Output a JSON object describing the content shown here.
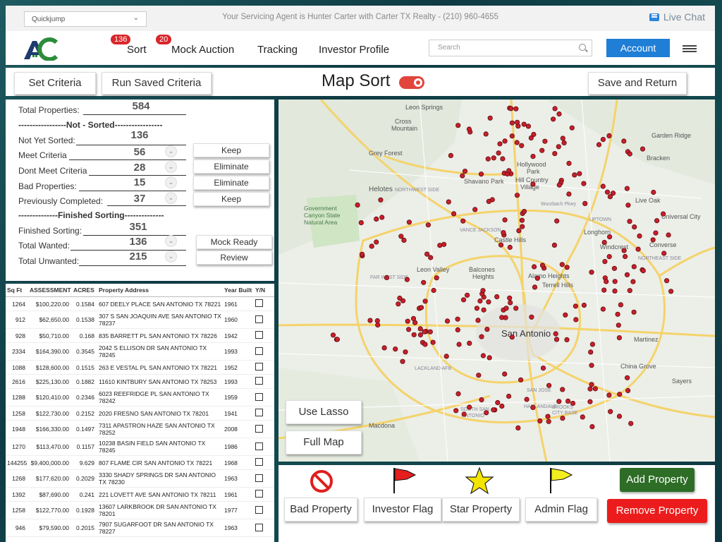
{
  "topbar": {
    "quickjump": "Quickjump",
    "agent_text": "Your Servicing Agent is Hunter Carter with Carter TX Realty - (210) 960-4655",
    "live_chat": "Live Chat"
  },
  "nav": {
    "logo_icon": "ac-house-logo",
    "items": [
      {
        "label": "Sort",
        "badge": "136"
      },
      {
        "label": "Mock Auction",
        "badge": "20"
      },
      {
        "label": "Tracking"
      },
      {
        "label": "Investor Profile"
      }
    ],
    "search_placeholder": "Search",
    "account": "Account"
  },
  "controls": {
    "set_criteria": "Set Criteria",
    "run_saved": "Run Saved Criteria",
    "title": "Map Sort",
    "toggle_on": true,
    "save_return": "Save and Return"
  },
  "stats": {
    "total_label": "Total Properties:",
    "total_value": "584",
    "not_sorted_sep": "-----------------Not - Sorted-----------------",
    "not_yet_label": "Not Yet Sorted:",
    "not_yet_value": "136",
    "rows": [
      {
        "label": "Meet Criteria",
        "value": "56",
        "button": "Keep"
      },
      {
        "label": "Dont Meet Criteria",
        "value": "28",
        "button": "Eliminate"
      },
      {
        "label": "Bad Properties:",
        "value": "15",
        "button": "Eliminate"
      },
      {
        "label": "Previously Completed:",
        "value": "37",
        "button": "Keep"
      }
    ],
    "finished_sep": "--------------Finished Sorting--------------",
    "finished_label": "Finished Sorting:",
    "finished_value": "351",
    "wanted_label": "Total Wanted:",
    "wanted_value": "136",
    "wanted_button": "Mock Ready",
    "unwanted_label": "Total Unwanted:",
    "unwanted_value": "215",
    "unwanted_button": "Review"
  },
  "table": {
    "headers": [
      "Sq Ft",
      "ASSESSMENT",
      "ACRES",
      "Property Address",
      "Year Built",
      "Y/N"
    ],
    "rows": [
      [
        "1264",
        "$100,220.00",
        "0.1584",
        "607 DEELY PLACE SAN ANTONIO TX 78221",
        "1961"
      ],
      [
        "912",
        "$62,650.00",
        "0.1538",
        "307 S SAN JOAQUIN AVE SAN ANTONIO TX 78237",
        "1960"
      ],
      [
        "928",
        "$50,710.00",
        "0.168",
        "835 BARRETT PL SAN ANTONIO TX 78226",
        "1942"
      ],
      [
        "2334",
        "$164,390.00",
        "0.3545",
        "2042 S ELLISON DR SAN ANTONIO TX 78245",
        "1993"
      ],
      [
        "1088",
        "$128,600.00",
        "0.1515",
        "263 E VESTAL PL SAN ANTONIO TX 78221",
        "1952"
      ],
      [
        "2616",
        "$225,130.00",
        "0.1882",
        "11610 KINTBURY SAN ANTONIO TX 78253",
        "1993"
      ],
      [
        "1288",
        "$120,410.00",
        "0.2346",
        "6023 REEFRIDGE PL SAN ANTONIO TX 78242",
        "1959"
      ],
      [
        "1258",
        "$122,730.00",
        "0.2152",
        "2020 FRESNO SAN ANTONIO TX 78201",
        "1941"
      ],
      [
        "1948",
        "$166,330.00",
        "0.1497",
        "7311 APASTRON HAZE SAN ANTONIO TX 78252",
        "2008"
      ],
      [
        "1270",
        "$113,470.00",
        "0.1157",
        "10238 BASIN FIELD SAN ANTONIO TX 78245",
        "1986"
      ],
      [
        "144255",
        "$9,400,000.00",
        "9.629",
        "807 FLAME CIR SAN ANTONIO TX 78221",
        "1968"
      ],
      [
        "1268",
        "$177,620.00",
        "0.2029",
        "3330 SHADY SPRINGS DR SAN ANTONIO TX 78230",
        "1963"
      ],
      [
        "1392",
        "$87,690.00",
        "0.241",
        "221 LOVETT AVE SAN ANTONIO TX 78211",
        "1961"
      ],
      [
        "1258",
        "$122,770.00",
        "0.1928",
        "13607 LARKBROOK DR SAN ANTONIO TX 78201",
        "1977"
      ],
      [
        "946",
        "$79,590.00",
        "0.2015",
        "7907 SUGARFOOT DR SAN ANTONIO TX 78227",
        "1963"
      ]
    ]
  },
  "map": {
    "use_lasso": "Use Lasso",
    "full_map": "Full Map",
    "labels": [
      "Leon Springs",
      "Cross Mountain",
      "Grey Forest",
      "Helotes",
      "Government Canyon State Natural Area",
      "Shavano Park",
      "Hollywood Park",
      "Hill Country Village",
      "Garden Ridge",
      "Bracken",
      "Live Oak",
      "Universal City",
      "Converse",
      "Windcrest",
      "Longhorn",
      "Castle Hills",
      "Balcones Heights",
      "Alamo Heights",
      "Terrell Hills",
      "Leon Valley",
      "San Antonio",
      "Lackland AFB",
      "China Grove",
      "Martinez",
      "Sayers",
      "Macdona",
      "South San Antonio",
      "Brooks City Base",
      "Uptown",
      "Northwest Side",
      "Far West Side",
      "Vance Jackson",
      "Northeast Side",
      "Harlandale",
      "San Jose",
      "Wurzbach Pkwy"
    ]
  },
  "actions": {
    "bad_property": "Bad Property",
    "investor_flag": "Investor Flag",
    "star_property": "Star Property",
    "admin_flag": "Admin Flag",
    "add_property": "Add Property",
    "remove_property": "Remove Property",
    "colors": {
      "investor_flag": "#e61e1e",
      "admin_flag": "#f3ee1f",
      "star": "#f5e400",
      "bad": "#e01e1e"
    }
  }
}
